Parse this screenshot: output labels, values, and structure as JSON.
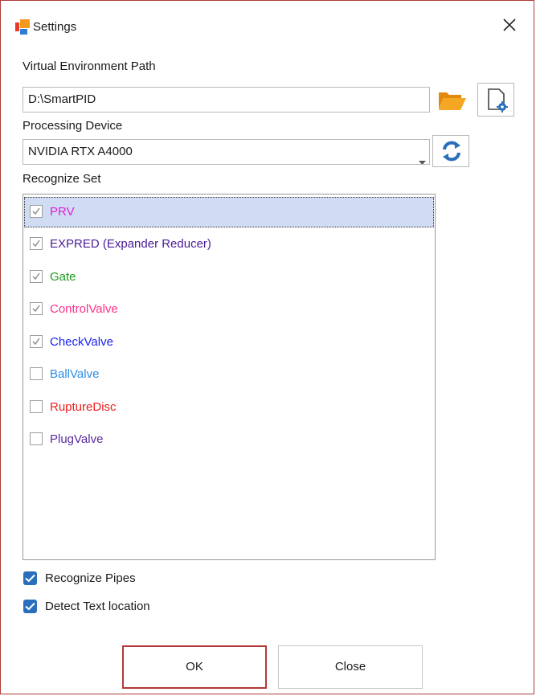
{
  "window": {
    "title": "Settings",
    "accent": "#b23a3a"
  },
  "venv": {
    "label": "Virtual Environment Path",
    "value": "D:\\SmartPID",
    "browse_icon": "folder-open-icon",
    "settings_icon": "document-gear-icon"
  },
  "device": {
    "label": "Processing Device",
    "value": "NVIDIA RTX A4000",
    "refresh_icon": "refresh-icon"
  },
  "recognize_set": {
    "label": "Recognize Set",
    "items": [
      {
        "label": "PRV",
        "checked": true,
        "color": "#e020d8",
        "selected": true
      },
      {
        "label": "EXPRED (Expander Reducer)",
        "checked": true,
        "color": "#4a1a9a",
        "selected": false
      },
      {
        "label": "Gate",
        "checked": true,
        "color": "#1e9a1e",
        "selected": false
      },
      {
        "label": "ControlValve",
        "checked": true,
        "color": "#ff2f8a",
        "selected": false
      },
      {
        "label": "CheckValve",
        "checked": true,
        "color": "#1a22ee",
        "selected": false
      },
      {
        "label": "BallValve",
        "checked": false,
        "color": "#2d8fe6",
        "selected": false
      },
      {
        "label": "RuptureDisc",
        "checked": false,
        "color": "#ee1d1d",
        "selected": false
      },
      {
        "label": "PlugValve",
        "checked": false,
        "color": "#5a2a9e",
        "selected": false
      }
    ]
  },
  "options": {
    "recognize_pipes": {
      "label": "Recognize Pipes",
      "checked": true
    },
    "detect_text": {
      "label": "Detect Text location",
      "checked": true
    }
  },
  "buttons": {
    "ok": "OK",
    "close": "Close"
  }
}
